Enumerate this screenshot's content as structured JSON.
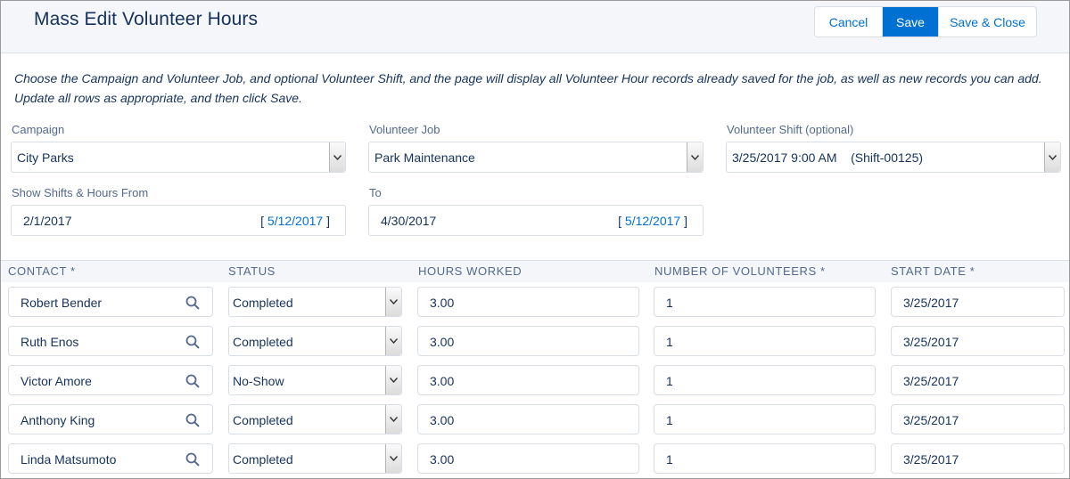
{
  "header": {
    "title": "Mass Edit Volunteer Hours",
    "buttons": {
      "cancel": "Cancel",
      "save": "Save",
      "save_close": "Save & Close"
    }
  },
  "instructions": "Choose the Campaign and Volunteer Job, and optional Volunteer Shift, and the page will display all Volunteer Hour records already saved for the job, as well as new records you can add. Update all rows as appropriate, and then click Save.",
  "filters": {
    "campaign": {
      "label": "Campaign",
      "value": "City Parks"
    },
    "job": {
      "label": "Volunteer Job",
      "value": "Park Maintenance"
    },
    "shift": {
      "label": "Volunteer Shift (optional)",
      "value": "3/25/2017 9:00 AM    (Shift-00125)"
    },
    "from": {
      "label": "Show Shifts & Hours From",
      "value": "2/1/2017",
      "today": "5/12/2017"
    },
    "to": {
      "label": "To",
      "value": "4/30/2017",
      "today": "5/12/2017"
    }
  },
  "table": {
    "columns": [
      "CONTACT *",
      "STATUS",
      "HOURS WORKED",
      "NUMBER OF VOLUNTEERS *",
      "START DATE *"
    ],
    "rows": [
      {
        "contact": "Robert Bender",
        "status": "Completed",
        "hours": "3.00",
        "volunteers": "1",
        "start": "3/25/2017"
      },
      {
        "contact": "Ruth Enos",
        "status": "Completed",
        "hours": "3.00",
        "volunteers": "1",
        "start": "3/25/2017"
      },
      {
        "contact": "Victor Amore",
        "status": "No-Show",
        "hours": "3.00",
        "volunteers": "1",
        "start": "3/25/2017"
      },
      {
        "contact": "Anthony King",
        "status": "Completed",
        "hours": "3.00",
        "volunteers": "1",
        "start": "3/25/2017"
      },
      {
        "contact": "Linda Matsumoto",
        "status": "Completed",
        "hours": "3.00",
        "volunteers": "1",
        "start": "3/25/2017"
      }
    ]
  },
  "icons": {
    "contact_lookup": "search-icon",
    "dropdown": "chevron-down-icon"
  },
  "colors": {
    "accent": "#0070d2",
    "header_bg": "#f4f6f9",
    "text": "#16325c",
    "label": "#54698d"
  }
}
